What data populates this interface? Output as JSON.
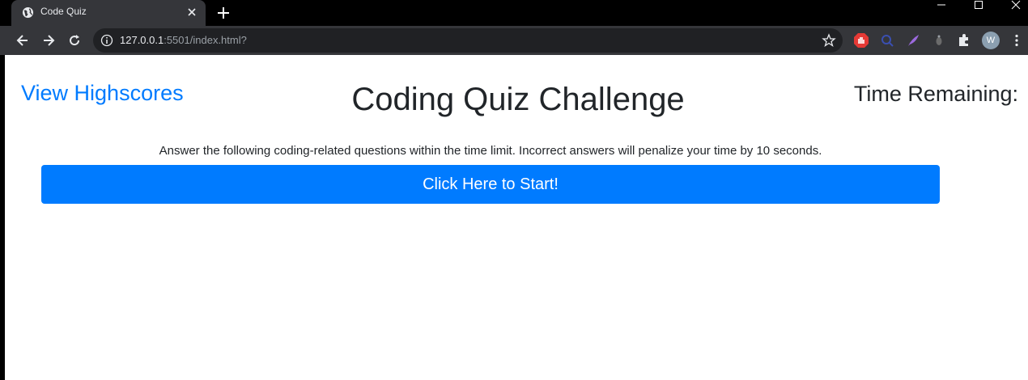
{
  "browser": {
    "tab_title": "Code Quiz",
    "url_host": "127.0.0.1",
    "url_path": ":5501/index.html?",
    "profile_initial": "W",
    "icons": [
      "globe-icon",
      "close-icon",
      "plus-icon",
      "minimize-icon",
      "maximize-icon",
      "close-window-icon",
      "back-arrow-icon",
      "forward-arrow-icon",
      "reload-icon",
      "info-icon",
      "star-icon",
      "adblock-icon",
      "extension-icon",
      "puzzle-icon",
      "kebab-menu-icon"
    ]
  },
  "header": {
    "highscores_link": "View Highscores",
    "title": "Coding Quiz Challenge",
    "timer_label": "Time Remaining:"
  },
  "main": {
    "instructions": "Answer the following coding-related questions within the time limit. Incorrect answers will penalize your time by 10 seconds.",
    "start_button": "Click Here to Start!"
  },
  "colors": {
    "accent": "#007bff",
    "text": "#212529",
    "chrome_bg": "#35363a"
  }
}
